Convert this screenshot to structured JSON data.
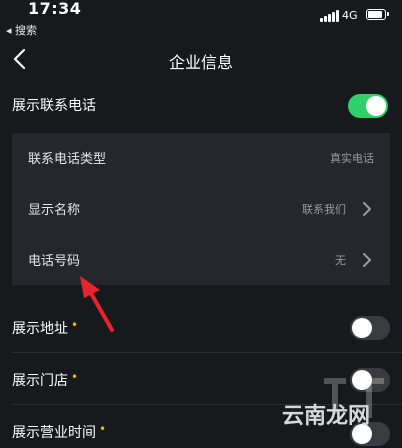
{
  "status_bar": {
    "time": "17:34",
    "back_app": "◂ 搜索",
    "network": "4G",
    "battery_level": 0.8
  },
  "nav": {
    "title": "企业信息",
    "back_icon": "chevron-left-icon"
  },
  "show_phone": {
    "label": "展示联系电话",
    "toggle": "on"
  },
  "phone_details": [
    {
      "label": "联系电话类型",
      "value": "真实电话",
      "has_chevron": false
    },
    {
      "label": "显示名称",
      "value": "联系我们",
      "has_chevron": true
    },
    {
      "label": "电话号码",
      "value": "无",
      "has_chevron": true
    }
  ],
  "show_address": {
    "label": "展示地址",
    "toggle": "off"
  },
  "show_store": {
    "label": "展示门店",
    "toggle": "off"
  },
  "show_hours": {
    "label": "展示营业时间",
    "toggle": "off"
  },
  "colors": {
    "background": "#18191d",
    "panel": "#26272d",
    "toggle_on": "#2fcf6a",
    "required_dot": "#f0b429",
    "annotation_arrow": "#e8232a"
  },
  "watermark": {
    "text": "云南龙网"
  }
}
